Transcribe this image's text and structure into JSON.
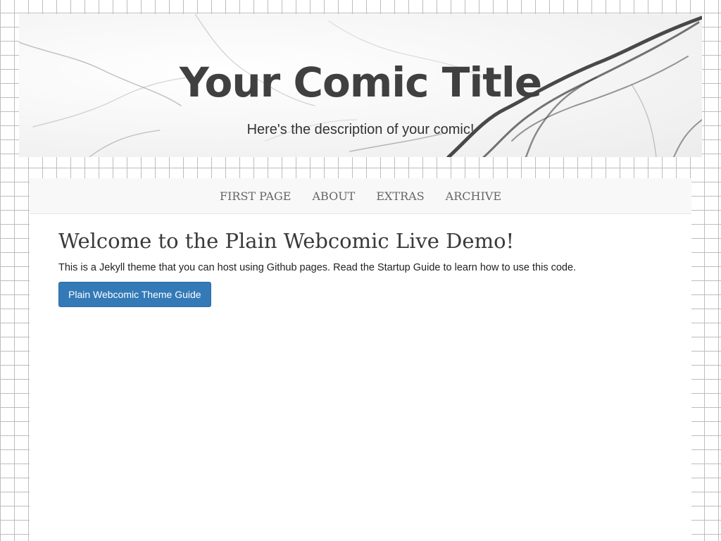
{
  "header": {
    "title": "Your Comic Title",
    "description": "Here's the description of your comic!"
  },
  "nav": {
    "items": [
      {
        "label": "FIRST PAGE"
      },
      {
        "label": "ABOUT"
      },
      {
        "label": "EXTRAS"
      },
      {
        "label": "ARCHIVE"
      }
    ]
  },
  "main": {
    "heading": "Welcome to the Plain Webcomic Live Demo!",
    "intro": "This is a Jekyll theme that you can host using Github pages. Read the Startup Guide to learn how to use this code.",
    "button_label": "Plain Webcomic Theme Guide"
  },
  "colors": {
    "button": "#337ab7",
    "nav_background": "#f8f8f8",
    "title_text": "#404040",
    "grid_lines": "#bdbdbd"
  }
}
